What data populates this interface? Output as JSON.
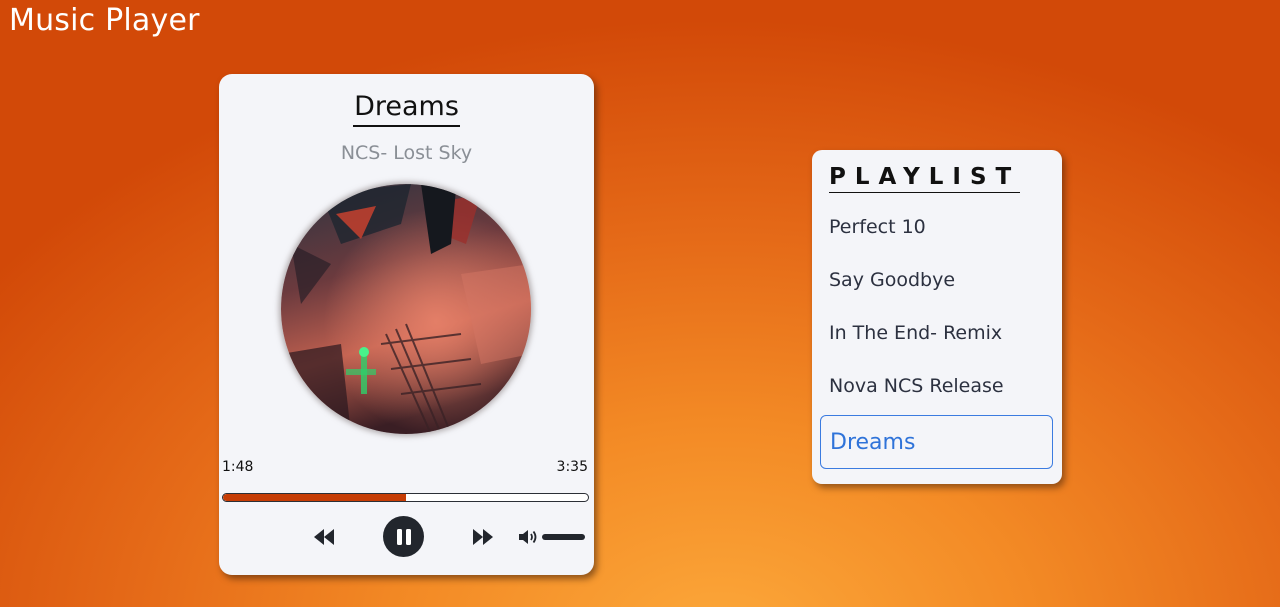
{
  "app": {
    "title": "Music Player"
  },
  "player": {
    "song_title": "Dreams",
    "artist": "NCS- Lost Sky",
    "current_time": "1:48",
    "total_time": "3:35",
    "progress_fraction": 0.5,
    "volume_fraction": 1.0,
    "state": "playing",
    "icons": {
      "prev": "rewind-icon",
      "play_pause": "pause-icon",
      "next": "fast-forward-icon",
      "volume": "volume-icon"
    }
  },
  "playlist": {
    "heading": "PLAYLIST",
    "items": [
      {
        "label": "Perfect 10",
        "active": false
      },
      {
        "label": "Say Goodbye",
        "active": false
      },
      {
        "label": "In The End- Remix",
        "active": false
      },
      {
        "label": "Nova NCS Release",
        "active": false
      },
      {
        "label": "Dreams",
        "active": true
      }
    ]
  },
  "colors": {
    "background_dark": "#d24908",
    "background_light": "#fca83a",
    "progress": "#c63d05",
    "active_item": "#2f73d9",
    "card": "#f4f5f9"
  }
}
